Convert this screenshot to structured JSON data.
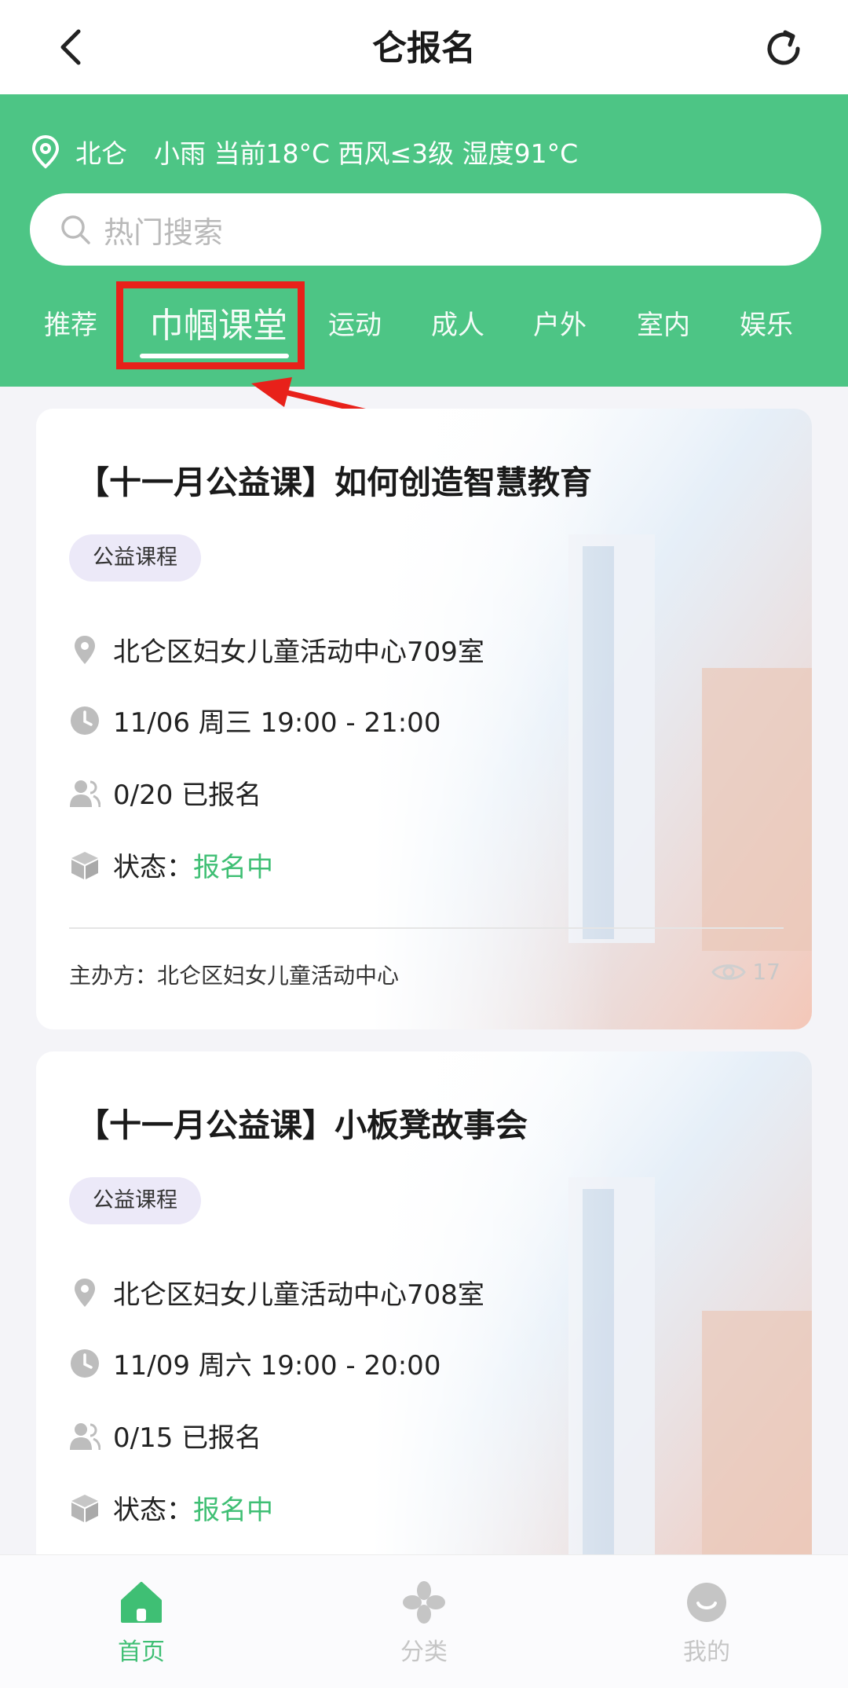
{
  "nav": {
    "title": "仑报名"
  },
  "weather": {
    "city": "北仑",
    "info": "小雨 当前18°C 西风≤3级 湿度91°C"
  },
  "search": {
    "placeholder": "热门搜索"
  },
  "tabs": [
    {
      "label": "推荐"
    },
    {
      "label": "巾帼课堂",
      "active": true
    },
    {
      "label": "运动"
    },
    {
      "label": "成人"
    },
    {
      "label": "户外"
    },
    {
      "label": "室内"
    },
    {
      "label": "娱乐"
    }
  ],
  "cards": [
    {
      "title": "【十一月公益课】如何创造智慧教育",
      "tag": "公益课程",
      "location": "北仑区妇女儿童活动中心709室",
      "time": "11/06 周三 19:00 - 21:00",
      "enrolled": "0/20 已报名",
      "status_label": "状态：",
      "status_value": "报名中",
      "organizer": "主办方：北仑区妇女儿童活动中心",
      "views": "17"
    },
    {
      "title": "【十一月公益课】小板凳故事会",
      "tag": "公益课程",
      "location": "北仑区妇女儿童活动中心708室",
      "time": "11/09 周六 19:00 - 20:00",
      "enrolled": "0/15 已报名",
      "status_label": "状态：",
      "status_value": "报名中"
    }
  ],
  "bottom_tabs": [
    {
      "label": "首页",
      "active": true
    },
    {
      "label": "分类"
    },
    {
      "label": "我的"
    }
  ],
  "colors": {
    "brand_green": "#4dc585",
    "status_green": "#3fbf74",
    "highlight_red": "#e8211a"
  }
}
